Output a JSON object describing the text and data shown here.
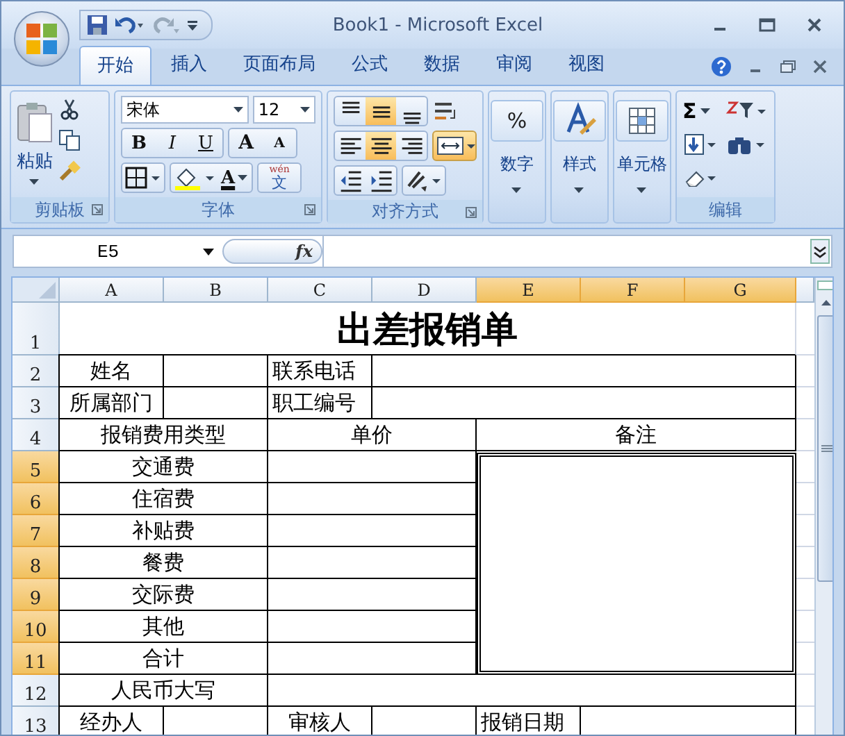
{
  "window": {
    "title": "Book1 - Microsoft Excel"
  },
  "tabs": [
    {
      "label": "开始",
      "selected": true
    },
    {
      "label": "插入",
      "selected": false
    },
    {
      "label": "页面布局",
      "selected": false
    },
    {
      "label": "公式",
      "selected": false
    },
    {
      "label": "数据",
      "selected": false
    },
    {
      "label": "审阅",
      "selected": false
    },
    {
      "label": "视图",
      "selected": false
    }
  ],
  "ribbon": {
    "clipboard": {
      "label": "剪贴板",
      "paste": "粘贴"
    },
    "font": {
      "label": "字体",
      "font_name": "宋体",
      "font_size": "12",
      "bold": "B",
      "italic": "I",
      "underline": "U",
      "grow": "A",
      "shrink": "A",
      "font_color": "A",
      "phonetic_top": "wén",
      "phonetic": "文"
    },
    "alignment": {
      "label": "对齐方式",
      "buttons": [
        {
          "kind": "top",
          "selected": false
        },
        {
          "kind": "middle",
          "selected": true
        },
        {
          "kind": "bottom",
          "selected": false
        },
        {
          "kind": "left",
          "selected": false
        },
        {
          "kind": "center",
          "selected": true
        },
        {
          "kind": "right",
          "selected": false
        }
      ],
      "merge_selected": true
    },
    "number": {
      "label": "数字",
      "symbol": "%"
    },
    "styles": {
      "label": "样式"
    },
    "cells": {
      "label": "单元格"
    },
    "editing": {
      "label": "编辑",
      "sum": "Σ"
    }
  },
  "formula_bar": {
    "name_box": "E5",
    "fx": "fx"
  },
  "columns": [
    {
      "label": "A",
      "selected": false
    },
    {
      "label": "B",
      "selected": false
    },
    {
      "label": "C",
      "selected": false
    },
    {
      "label": "D",
      "selected": false
    },
    {
      "label": "E",
      "selected": true
    },
    {
      "label": "F",
      "selected": true
    },
    {
      "label": "G",
      "selected": true
    }
  ],
  "rows": [
    {
      "number": "1",
      "selected": false,
      "cells": [
        "出差报销单"
      ]
    },
    {
      "number": "2",
      "selected": false,
      "cells": [
        "姓名",
        "联系电话"
      ]
    },
    {
      "number": "3",
      "selected": false,
      "cells": [
        "所属部门",
        "职工编号"
      ]
    },
    {
      "number": "4",
      "selected": false,
      "cells": [
        "报销费用类型",
        "单价",
        "备注"
      ]
    },
    {
      "number": "5",
      "selected": true,
      "cells": [
        "交通费"
      ]
    },
    {
      "number": "6",
      "selected": true,
      "cells": [
        "住宿费"
      ]
    },
    {
      "number": "7",
      "selected": true,
      "cells": [
        "补贴费"
      ]
    },
    {
      "number": "8",
      "selected": true,
      "cells": [
        "餐费"
      ]
    },
    {
      "number": "9",
      "selected": true,
      "cells": [
        "交际费"
      ]
    },
    {
      "number": "10",
      "selected": true,
      "cells": [
        "其他"
      ]
    },
    {
      "number": "11",
      "selected": true,
      "cells": [
        "合计"
      ]
    },
    {
      "number": "12",
      "selected": false,
      "cells": [
        "人民币大写"
      ]
    },
    {
      "number": "13",
      "selected": false,
      "cells": [
        "经办人",
        "审核人",
        "报销日期"
      ]
    }
  ]
}
